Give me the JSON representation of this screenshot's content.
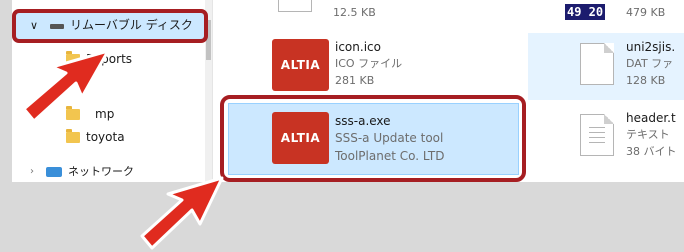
{
  "nav": {
    "drive_label": "リムーバブル ディスク",
    "folders": [
      "Reports",
      "mp",
      "toyota"
    ],
    "network_label": "ネットワーク"
  },
  "files": {
    "top_partial": {
      "size": "12.5 KB"
    },
    "top_right_partial": {
      "badge": "49 20",
      "size": "479 KB"
    },
    "icon": {
      "name": "icon.ico",
      "type": "ICO ファイル",
      "size": "281 KB",
      "logo": "ALTIA"
    },
    "sss": {
      "name": "sss-a.exe",
      "desc": "SSS-a Update tool",
      "company": "ToolPlanet Co. LTD",
      "logo": "ALTIA"
    },
    "uni2sjis": {
      "name": "uni2sjis.",
      "type": "DAT ファ",
      "size": "128 KB"
    },
    "header": {
      "name": "header.t",
      "type": "テキスト",
      "size": "38 バイト"
    }
  },
  "colors": {
    "highlight": "#a61e22",
    "arrow": "#e02b1f",
    "selection": "#cce8ff",
    "altia_red": "#c83323"
  }
}
